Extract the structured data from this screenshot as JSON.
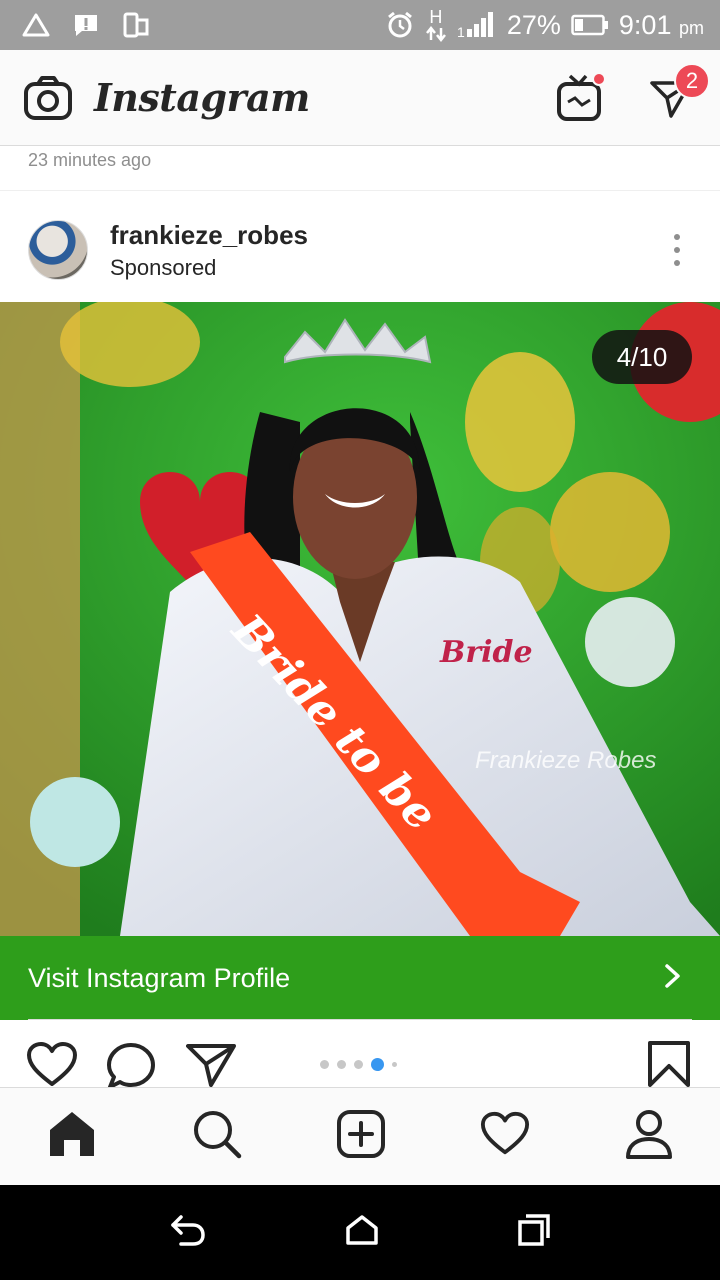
{
  "status_bar": {
    "battery_percent": "27%",
    "time": "9:01",
    "ampm": "pm",
    "network": "H"
  },
  "app": {
    "title": "Instagram",
    "direct_badge_count": "2"
  },
  "feed": {
    "timestamp": "23 minutes ago",
    "post": {
      "username": "frankieze_robes",
      "sponsored_label": "Sponsored",
      "image_counter": "4/10",
      "watermark": "Frankieze Robes",
      "sash_text": "Bride to be",
      "robe_text": "Bride",
      "cta_label": "Visit Instagram Profile",
      "carousel": {
        "total_dots": 5,
        "active_index": 3
      }
    }
  },
  "colors": {
    "cta_green": "#2e9e1b",
    "badge_red": "#ed4956",
    "status_gray": "#9e9e9e"
  },
  "icons": {
    "status": [
      "warning-icon",
      "alert-icon",
      "screen-icon",
      "alarm-icon",
      "data-arrows-icon",
      "signal-icon",
      "battery-icon"
    ],
    "top_bar": [
      "camera-icon",
      "igtv-icon",
      "direct-message-icon"
    ],
    "post_actions": [
      "heart-icon",
      "comment-icon",
      "share-icon",
      "bookmark-icon"
    ],
    "bottom_nav": [
      "home-icon",
      "search-icon",
      "add-post-icon",
      "activity-heart-icon",
      "profile-icon"
    ],
    "system_nav": [
      "back-icon",
      "home-outline-icon",
      "recents-icon"
    ]
  }
}
